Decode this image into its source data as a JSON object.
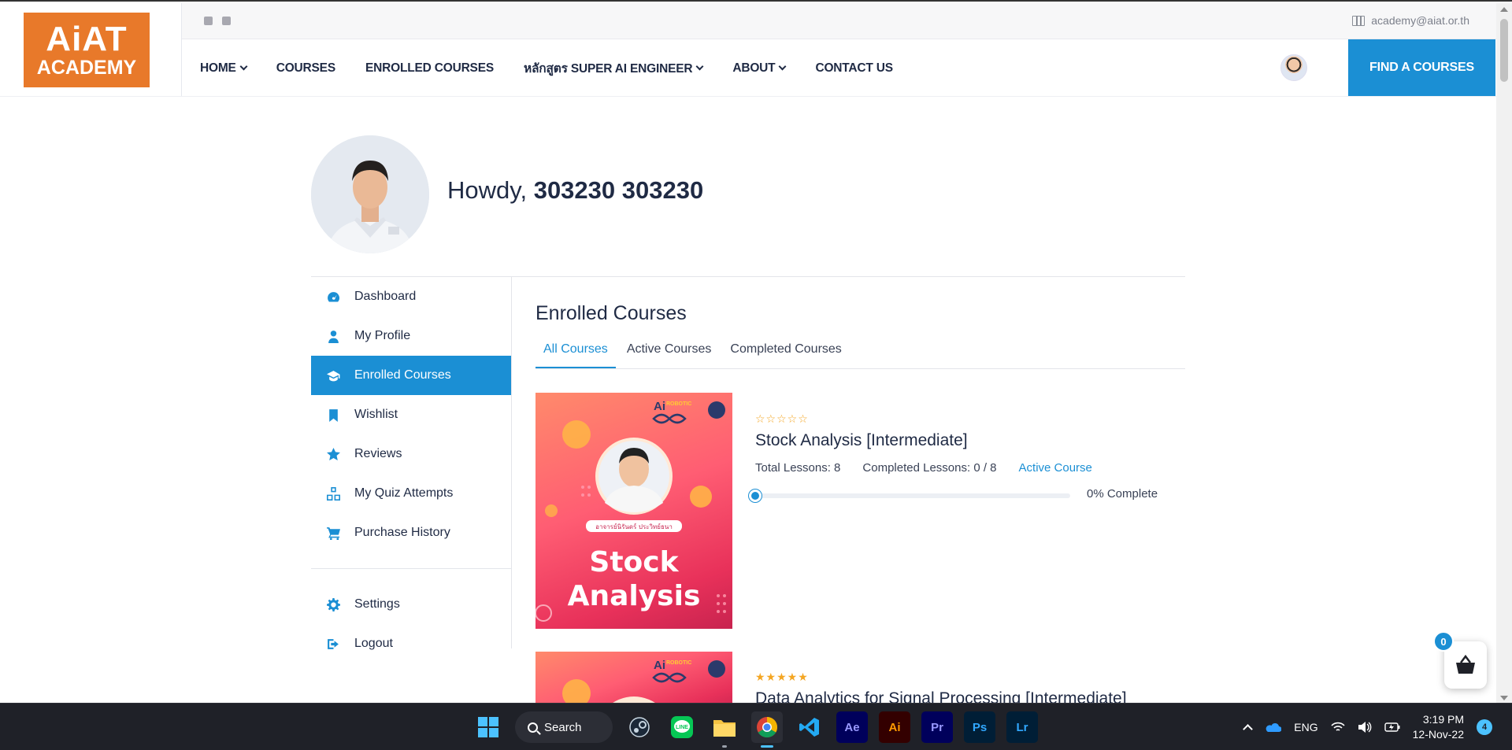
{
  "logo": {
    "line1": "AiAT",
    "line2": "ACADEMY"
  },
  "topbar": {
    "email": "academy@aiat.or.th"
  },
  "nav": {
    "items": [
      {
        "label": "HOME",
        "dropdown": true
      },
      {
        "label": "COURSES",
        "dropdown": false
      },
      {
        "label": "ENROLLED COURSES",
        "dropdown": false
      },
      {
        "label": "หลักสูตร SUPER AI ENGINEER",
        "dropdown": true
      },
      {
        "label": "ABOUT",
        "dropdown": true
      },
      {
        "label": "CONTACT US",
        "dropdown": false
      }
    ],
    "cta": "FIND A COURSES"
  },
  "profile": {
    "greeting": "Howdy,",
    "name": "303230 303230"
  },
  "sidebar": {
    "items": [
      {
        "label": "Dashboard",
        "icon": "dashboard-icon"
      },
      {
        "label": "My Profile",
        "icon": "user-icon"
      },
      {
        "label": "Enrolled Courses",
        "icon": "graduation-cap-icon",
        "active": true
      },
      {
        "label": "Wishlist",
        "icon": "bookmark-icon"
      },
      {
        "label": "Reviews",
        "icon": "star-icon"
      },
      {
        "label": "My Quiz Attempts",
        "icon": "cubes-icon"
      },
      {
        "label": "Purchase History",
        "icon": "cart-icon"
      }
    ],
    "bottom": [
      {
        "label": "Settings",
        "icon": "gear-icon"
      },
      {
        "label": "Logout",
        "icon": "logout-icon"
      }
    ]
  },
  "main": {
    "title": "Enrolled Courses",
    "tabs": [
      {
        "label": "All Courses",
        "active": true
      },
      {
        "label": "Active Courses"
      },
      {
        "label": "Completed Courses"
      }
    ],
    "courses": [
      {
        "thumb_title_1": "Stock",
        "thumb_title_2": "Analysis",
        "thumb_instructor": "อาจารย์นิรันดร์ ประวิทย์ธนา",
        "rating_stars": "☆☆☆☆☆",
        "rating": 0,
        "name": "Stock Analysis [Intermediate]",
        "total_lessons": "Total Lessons: 8",
        "completed_lessons": "Completed Lessons: 0 / 8",
        "status": "Active Course",
        "progress": 0,
        "progress_text": "0% Complete"
      },
      {
        "rating_stars": "★★★★★",
        "rating": 5,
        "name": "Data Analytics for Signal Processing [Intermediate]"
      }
    ]
  },
  "cart": {
    "count": "0"
  },
  "taskbar": {
    "search": "Search",
    "apps": [
      "steam-icon",
      "line-icon",
      "file-explorer-icon",
      "chrome-icon",
      "vscode-icon",
      "after-effects-icon",
      "illustrator-icon",
      "premiere-icon",
      "photoshop-icon",
      "lightroom-icon"
    ],
    "app_labels": {
      "ae": "Ae",
      "ai": "Ai",
      "pr": "Pr",
      "ps": "Ps",
      "lr": "Lr"
    },
    "lang": "ENG",
    "time": "3:19 PM",
    "date": "12-Nov-22",
    "notifications": "4"
  },
  "colors": {
    "accent": "#1b8fd4",
    "brand": "#e8792a",
    "star": "#f4a623"
  }
}
